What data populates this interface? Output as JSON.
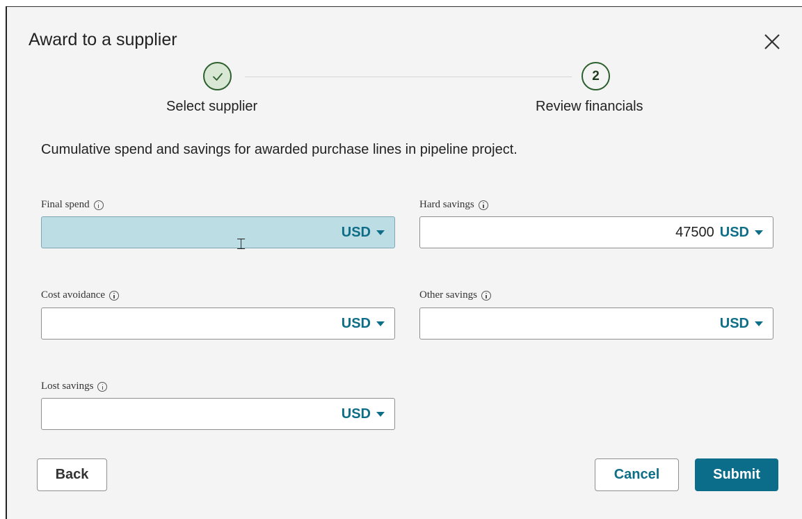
{
  "page_header_fragment": "",
  "dialog": {
    "title": "Award to a supplier",
    "close_icon": "close-icon"
  },
  "stepper": {
    "steps": [
      {
        "label": "Select supplier",
        "state": "completed",
        "icon": "check-icon"
      },
      {
        "label": "Review financials",
        "state": "current",
        "number": "2"
      }
    ]
  },
  "description": "Cumulative spend and savings for awarded purchase lines in pipeline project.",
  "fields": {
    "final_spend": {
      "label": "Final spend",
      "value": "",
      "currency": "USD"
    },
    "hard_savings": {
      "label": "Hard savings",
      "value": "47500",
      "currency": "USD"
    },
    "cost_avoidance": {
      "label": "Cost avoidance",
      "value": "",
      "currency": "USD"
    },
    "other_savings": {
      "label": "Other savings",
      "value": "",
      "currency": "USD"
    },
    "lost_savings": {
      "label": "Lost savings",
      "value": "",
      "currency": "USD"
    }
  },
  "buttons": {
    "back": "Back",
    "cancel": "Cancel",
    "submit": "Submit"
  },
  "colors": {
    "accent": "#0f6e87",
    "submit_bg": "#0c6d8a",
    "focused_field_bg": "#bddde5",
    "step_ring": "#2c5f2e"
  }
}
